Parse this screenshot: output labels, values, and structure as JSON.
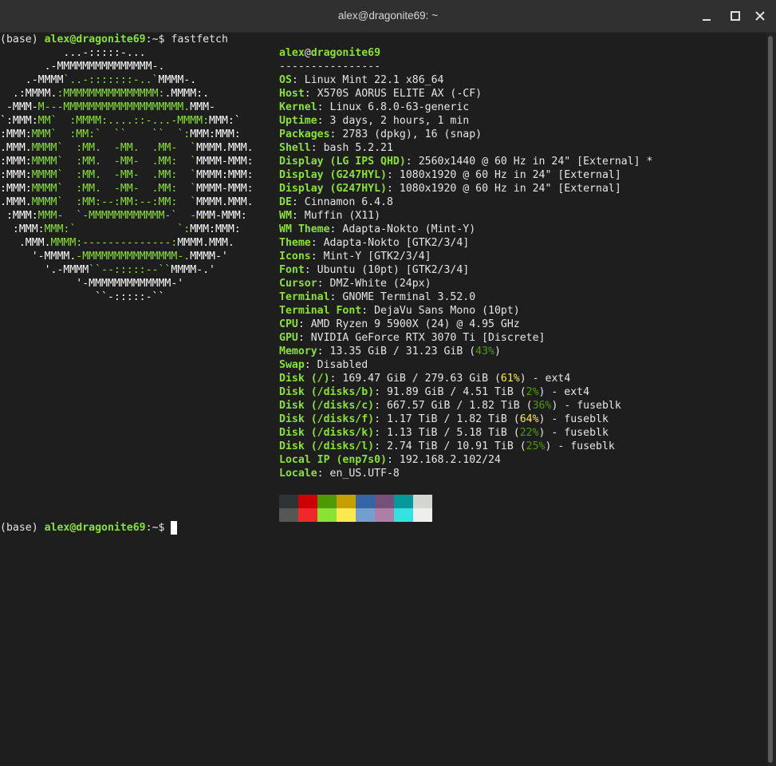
{
  "window": {
    "title": "alex@dragonite69: ~"
  },
  "prompt": {
    "env": "(base)",
    "userhost": "alex@dragonite69",
    "path": ":~",
    "symbol": "$",
    "command": "fastfetch"
  },
  "logo_lines": [
    [
      [
        "a",
        "          ...-:::::-..."
      ]
    ],
    [
      [
        "a",
        "       .-MMMMMMMMMMMMMMM-."
      ]
    ],
    [
      [
        "a",
        "    .-MMMM"
      ],
      [
        "b",
        "`..-:::::::-..`"
      ],
      [
        "a",
        "MMMM-."
      ]
    ],
    [
      [
        "a",
        "  .:MMMM."
      ],
      [
        "b",
        ":MMMMMMMMMMMMMMM:"
      ],
      [
        "a",
        ".MMMM:."
      ]
    ],
    [
      [
        "a",
        " -MMM-"
      ],
      [
        "b",
        "M---MMMMMMMMMMMMMMMMMMM."
      ],
      [
        "a",
        "MMM-"
      ]
    ],
    [
      [
        "a",
        "`:MMM:"
      ],
      [
        "b",
        "MM`  :MMMM:....::-...-MMMM:"
      ],
      [
        "a",
        "MMM:`"
      ]
    ],
    [
      [
        "a",
        ":MMM:"
      ],
      [
        "b",
        "MMM`  :MM:`  ``    ``  `:"
      ],
      [
        "a",
        "MMM:MMM:"
      ]
    ],
    [
      [
        "a",
        ".MMM."
      ],
      [
        "b",
        "MMMM`  :MM.  -MM.  .MM-  `"
      ],
      [
        "a",
        "MMMM.MMM."
      ]
    ],
    [
      [
        "a",
        ":MMM:"
      ],
      [
        "b",
        "MMMM`  :MM.  -MM-  .MM:  `"
      ],
      [
        "a",
        "MMMM-MMM:"
      ]
    ],
    [
      [
        "a",
        ":MMM:"
      ],
      [
        "b",
        "MMMM`  :MM.  -MM-  .MM:  `"
      ],
      [
        "a",
        "MMMM:MMM:"
      ]
    ],
    [
      [
        "a",
        ":MMM:"
      ],
      [
        "b",
        "MMMM`  :MM.  -MM-  .MM:  `"
      ],
      [
        "a",
        "MMMM-MMM:"
      ]
    ],
    [
      [
        "a",
        ".MMM."
      ],
      [
        "b",
        "MMMM`  :MM:--:MM:--:MM:  `"
      ],
      [
        "a",
        "MMMM.MMM."
      ]
    ],
    [
      [
        "a",
        " :MMM:"
      ],
      [
        "b",
        "MMM-  `-MMMMMMMMMMMM-`  -"
      ],
      [
        "a",
        "MMM-MMM:"
      ]
    ],
    [
      [
        "a",
        "  :MMM:"
      ],
      [
        "b",
        "MMM:`                `:"
      ],
      [
        "a",
        "MMM:MMM:"
      ]
    ],
    [
      [
        "a",
        "   .MMM."
      ],
      [
        "b",
        "MMMM:--------------:"
      ],
      [
        "a",
        "MMMM.MMM."
      ]
    ],
    [
      [
        "a",
        "     '-MMMM."
      ],
      [
        "b",
        "-MMMMMMMMMMMMMMM-."
      ],
      [
        "a",
        "MMMM-'"
      ]
    ],
    [
      [
        "a",
        "       '.-MMMM"
      ],
      [
        "b",
        "``--:::::--``"
      ],
      [
        "a",
        "MMMM-.'"
      ]
    ],
    [
      [
        "a",
        "            '-MMMMMMMMMMMMM-'"
      ]
    ],
    [
      [
        "a",
        "               ``-:::::-``"
      ]
    ]
  ],
  "info": {
    "user": "alex",
    "at": "@",
    "host": "dragonite69",
    "separator": "----------------",
    "rows": [
      {
        "key": "OS",
        "segs": [
          [
            "w",
            "Linux Mint 22.1 x86_64"
          ]
        ]
      },
      {
        "key": "Host",
        "segs": [
          [
            "w",
            "X570S AORUS ELITE AX (-CF)"
          ]
        ]
      },
      {
        "key": "Kernel",
        "segs": [
          [
            "w",
            "Linux 6.8.0-63-generic"
          ]
        ]
      },
      {
        "key": "Uptime",
        "segs": [
          [
            "w",
            "3 days, 2 hours, 1 min"
          ]
        ]
      },
      {
        "key": "Packages",
        "segs": [
          [
            "w",
            "2783 (dpkg), 16 (snap)"
          ]
        ]
      },
      {
        "key": "Shell",
        "segs": [
          [
            "w",
            "bash 5.2.21"
          ]
        ]
      },
      {
        "key": "Display (LG IPS QHD)",
        "segs": [
          [
            "w",
            "2560x1440 @ 60 Hz in 24\" [External] *"
          ]
        ]
      },
      {
        "key": "Display (G247HYL)",
        "segs": [
          [
            "w",
            "1080x1920 @ 60 Hz in 24\" [External]"
          ]
        ]
      },
      {
        "key": "Display (G247HYL)",
        "segs": [
          [
            "w",
            "1080x1920 @ 60 Hz in 24\" [External]"
          ]
        ]
      },
      {
        "key": "DE",
        "segs": [
          [
            "w",
            "Cinnamon 6.4.8"
          ]
        ]
      },
      {
        "key": "WM",
        "segs": [
          [
            "w",
            "Muffin (X11)"
          ]
        ]
      },
      {
        "key": "WM Theme",
        "segs": [
          [
            "w",
            "Adapta-Nokto (Mint-Y)"
          ]
        ]
      },
      {
        "key": "Theme",
        "segs": [
          [
            "w",
            "Adapta-Nokto [GTK2/3/4]"
          ]
        ]
      },
      {
        "key": "Icons",
        "segs": [
          [
            "w",
            "Mint-Y [GTK2/3/4]"
          ]
        ]
      },
      {
        "key": "Font",
        "segs": [
          [
            "w",
            "Ubuntu (10pt) [GTK2/3/4]"
          ]
        ]
      },
      {
        "key": "Cursor",
        "segs": [
          [
            "w",
            "DMZ-White (24px)"
          ]
        ]
      },
      {
        "key": "Terminal",
        "segs": [
          [
            "w",
            "GNOME Terminal 3.52.0"
          ]
        ]
      },
      {
        "key": "Terminal Font",
        "segs": [
          [
            "w",
            "DejaVu Sans Mono (10pt)"
          ]
        ]
      },
      {
        "key": "CPU",
        "segs": [
          [
            "w",
            "AMD Ryzen 9 5900X (24) @ 4.95 GHz"
          ]
        ]
      },
      {
        "key": "GPU",
        "segs": [
          [
            "w",
            "NVIDIA GeForce RTX 3070 Ti [Discrete]"
          ]
        ]
      },
      {
        "key": "Memory",
        "segs": [
          [
            "w",
            "13.35 GiB / 31.23 GiB ("
          ],
          [
            "pct-g",
            "43%"
          ],
          [
            "w",
            ")"
          ]
        ]
      },
      {
        "key": "Swap",
        "segs": [
          [
            "w",
            "Disabled"
          ]
        ]
      },
      {
        "key": "Disk (/)",
        "segs": [
          [
            "w",
            "169.47 GiB / 279.63 GiB ("
          ],
          [
            "pct-y",
            "61%"
          ],
          [
            "w",
            ") - ext4"
          ]
        ]
      },
      {
        "key": "Disk (/disks/b)",
        "segs": [
          [
            "w",
            "91.89 GiB / 4.51 TiB ("
          ],
          [
            "pct-g",
            "2%"
          ],
          [
            "w",
            ") - ext4"
          ]
        ]
      },
      {
        "key": "Disk (/disks/c)",
        "segs": [
          [
            "w",
            "667.57 GiB / 1.82 TiB ("
          ],
          [
            "pct-g",
            "36%"
          ],
          [
            "w",
            ") - fuseblk"
          ]
        ]
      },
      {
        "key": "Disk (/disks/f)",
        "segs": [
          [
            "w",
            "1.17 TiB / 1.82 TiB ("
          ],
          [
            "pct-y",
            "64%"
          ],
          [
            "w",
            ") - fuseblk"
          ]
        ]
      },
      {
        "key": "Disk (/disks/k)",
        "segs": [
          [
            "w",
            "1.13 TiB / 5.18 TiB ("
          ],
          [
            "pct-g",
            "22%"
          ],
          [
            "w",
            ") - fuseblk"
          ]
        ]
      },
      {
        "key": "Disk (/disks/l)",
        "segs": [
          [
            "w",
            "2.74 TiB / 10.91 TiB ("
          ],
          [
            "pct-g",
            "25%"
          ],
          [
            "w",
            ") - fuseblk"
          ]
        ]
      },
      {
        "key": "Local IP (enp7s0)",
        "segs": [
          [
            "w",
            "192.168.2.102/24"
          ]
        ]
      },
      {
        "key": "Locale",
        "segs": [
          [
            "w",
            "en_US.UTF-8"
          ]
        ]
      }
    ]
  },
  "palette": {
    "normal": [
      "#2e3436",
      "#cc0000",
      "#4e9a06",
      "#c4a000",
      "#3465a4",
      "#75507b",
      "#06989a",
      "#d3d7cf"
    ],
    "bright": [
      "#555753",
      "#ef2929",
      "#8ae234",
      "#fce94f",
      "#729fcf",
      "#ad7fa8",
      "#34e2e2",
      "#eeeeec"
    ]
  }
}
